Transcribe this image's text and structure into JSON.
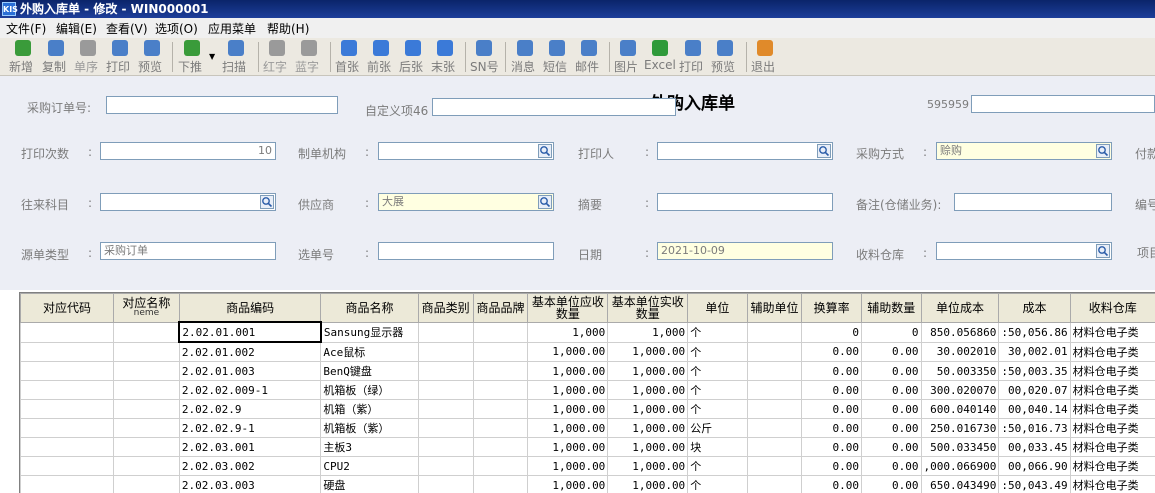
{
  "window": {
    "title": "外购入库单 - 修改 - WIN000001",
    "app_icon": "KIS"
  },
  "menu": [
    "文件(F)",
    "编辑(E)",
    "查看(V)",
    "选项(O)",
    "应用菜单",
    "帮助(H)"
  ],
  "toolbar": [
    {
      "label": "新增",
      "icon": "add-icon",
      "color": "#3a9b3a"
    },
    {
      "label": "复制",
      "icon": "copy-icon",
      "color": "#4a7fc8"
    },
    {
      "label": "单序",
      "icon": "sort-icon",
      "color": "#9a9a9a",
      "disabled": true
    },
    {
      "label": "打印",
      "icon": "print-icon",
      "color": "#4a7fc8"
    },
    {
      "label": "预览",
      "icon": "preview-icon",
      "color": "#4a7fc8"
    },
    {
      "label": "下推",
      "icon": "push-down-icon",
      "color": "#3a9b3a"
    },
    {
      "label": "扫描",
      "icon": "scan-icon",
      "color": "#4a7fc8"
    },
    {
      "label": "红字",
      "icon": "red-letter-icon",
      "color": "#9a9a9a",
      "disabled": true
    },
    {
      "label": "蓝字",
      "icon": "blue-letter-icon",
      "color": "#9a9a9a",
      "disabled": true
    },
    {
      "label": "首张",
      "icon": "first-icon",
      "color": "#3b7ad8"
    },
    {
      "label": "前张",
      "icon": "prev-icon",
      "color": "#3b7ad8"
    },
    {
      "label": "后张",
      "icon": "next-icon",
      "color": "#3b7ad8"
    },
    {
      "label": "末张",
      "icon": "last-icon",
      "color": "#3b7ad8"
    },
    {
      "label": "SN号",
      "icon": "sn-icon",
      "color": "#4a7fc8"
    },
    {
      "label": "消息",
      "icon": "message-icon",
      "color": "#4a7fc8"
    },
    {
      "label": "短信",
      "icon": "sms-icon",
      "color": "#4a7fc8"
    },
    {
      "label": "邮件",
      "icon": "mail-icon",
      "color": "#4a7fc8"
    },
    {
      "label": "图片",
      "icon": "picture-icon",
      "color": "#4a7fc8"
    },
    {
      "label": "Excel",
      "icon": "excel-icon",
      "color": "#2f9a3a"
    },
    {
      "label": "打印",
      "icon": "print-icon",
      "color": "#4a7fc8"
    },
    {
      "label": "预览",
      "icon": "preview-icon",
      "color": "#4a7fc8"
    },
    {
      "label": "退出",
      "icon": "exit-icon",
      "color": "#e08a2a"
    }
  ],
  "form": {
    "doc_title": "外购入库单",
    "po_number_label": "采购订单号:",
    "custom46_label": "自定义项46",
    "f595959_label": "595959",
    "print_count_label": "打印次数",
    "print_count_value": "10",
    "maker_org_label": "制单机构",
    "printer_label": "打印人",
    "purchase_method_label": "采购方式",
    "purchase_method_value": "赊购",
    "payment_label": "付款",
    "account_label": "往来科目",
    "supplier_label": "供应商",
    "supplier_value": "大展",
    "summary_label": "摘要",
    "remark_label": "备注(仓储业务):",
    "number_label": "编号",
    "source_type_label": "源单类型",
    "source_type_value": "采购订单",
    "select_no_label": "选单号",
    "date_label": "日期",
    "date_value": "2021-10-09",
    "warehouse_label": "收料仓库",
    "project_label": "项目",
    "colon": ":"
  },
  "table": {
    "headers": [
      "对应代码",
      "对应名称",
      "商品编码",
      "商品名称",
      "商品类别",
      "商品品牌",
      "基本单位应收数量",
      "基本单位实收数量",
      "单位",
      "辅助单位",
      "换算率",
      "辅助数量",
      "单位成本",
      "成本",
      "收料仓库"
    ],
    "sub_header": "neme",
    "rows": [
      [
        "",
        "",
        "2.02.01.001",
        "Sansung显示器",
        "",
        "",
        "1,000",
        "1,000",
        "个",
        "",
        "0",
        "0",
        "850.056860",
        ":50,056.86",
        "材料仓电子类"
      ],
      [
        "",
        "",
        "2.02.01.002",
        "Ace鼠标",
        "",
        "",
        "1,000.00",
        "1,000.00",
        "个",
        "",
        "0.00",
        "0.00",
        "30.002010",
        "30,002.01",
        "材料仓电子类"
      ],
      [
        "",
        "",
        "2.02.01.003",
        "BenQ键盘",
        "",
        "",
        "1,000.00",
        "1,000.00",
        "个",
        "",
        "0.00",
        "0.00",
        "50.003350",
        ":50,003.35",
        "材料仓电子类"
      ],
      [
        "",
        "",
        "2.02.02.009-1",
        "机箱板（绿）",
        "",
        "",
        "1,000.00",
        "1,000.00",
        "个",
        "",
        "0.00",
        "0.00",
        "300.020070",
        "00,020.07",
        "材料仓电子类"
      ],
      [
        "",
        "",
        "2.02.02.9",
        "机箱（紫）",
        "",
        "",
        "1,000.00",
        "1,000.00",
        "个",
        "",
        "0.00",
        "0.00",
        "600.040140",
        "00,040.14",
        "材料仓电子类"
      ],
      [
        "",
        "",
        "2.02.02.9-1",
        "机箱板（紫）",
        "",
        "",
        "1,000.00",
        "1,000.00",
        "公斤",
        "",
        "0.00",
        "0.00",
        "250.016730",
        ":50,016.73",
        "材料仓电子类"
      ],
      [
        "",
        "",
        "2.02.03.001",
        "主板3",
        "",
        "",
        "1,000.00",
        "1,000.00",
        "块",
        "",
        "0.00",
        "0.00",
        "500.033450",
        "00,033.45",
        "材料仓电子类"
      ],
      [
        "",
        "",
        "2.02.03.002",
        "CPU2",
        "",
        "",
        "1,000.00",
        "1,000.00",
        "个",
        "",
        "0.00",
        "0.00",
        ",000.066900",
        "00,066.90",
        "材料仓电子类"
      ],
      [
        "",
        "",
        "2.02.03.003",
        "硬盘",
        "",
        "",
        "1,000.00",
        "1,000.00",
        "个",
        "",
        "0.00",
        "0.00",
        "650.043490",
        ":50,043.49",
        "材料仓电子类"
      ]
    ]
  }
}
